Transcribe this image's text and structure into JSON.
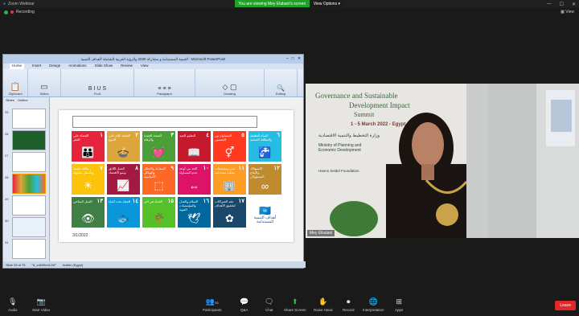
{
  "window": {
    "title": "Zoom Webinar",
    "recording_label": "Recording",
    "view_label": "View"
  },
  "share_banner": {
    "text": "You are viewing Mey Elabani's screen",
    "view_options": "View Options"
  },
  "powerpoint": {
    "title": "التنمية المستدامة و مشاركة 2030 والرؤية العربية الشاملة لأهداف التنمية - Microsoft PowerPoint",
    "tabs": [
      "Home",
      "Insert",
      "Design",
      "Animations",
      "Slide Show",
      "Review",
      "View"
    ],
    "ribbon_groups": [
      "Clipboard",
      "Slides",
      "Font",
      "Paragraph",
      "Drawing",
      "Editing"
    ],
    "sidebar_tabs": [
      "Slides",
      "Outline"
    ],
    "slide_numbers": [
      "25",
      "26",
      "27",
      "28",
      "29",
      "30",
      "31"
    ],
    "slide_date": "3/1/2022",
    "status": {
      "slide": "Slide 28 of 75",
      "theme": "\"8_cdb39e4124f\"",
      "language": "Arabic (Egypt)"
    },
    "sdg_tiles": [
      {
        "num": "١",
        "label": "القضاء على الفقر",
        "color": "#e5243b",
        "icon": "👪"
      },
      {
        "num": "٢",
        "label": "القضاء التام على الجوع",
        "color": "#dda63a",
        "icon": "🍲"
      },
      {
        "num": "٣",
        "label": "الصحة الجيدة والرفاه",
        "color": "#4c9f38",
        "icon": "💓"
      },
      {
        "num": "٤",
        "label": "التعليم الجيد",
        "color": "#c5192d",
        "icon": "📖"
      },
      {
        "num": "٥",
        "label": "المساواة بين الجنسين",
        "color": "#ff3a21",
        "icon": "⚥"
      },
      {
        "num": "٦",
        "label": "المياه النظيفة والنظافة الصحية",
        "color": "#26bde2",
        "icon": "🚰"
      },
      {
        "num": "٧",
        "label": "طاقة نظيفة وبأسعار معقولة",
        "color": "#fcc30b",
        "icon": "☀"
      },
      {
        "num": "٨",
        "label": "العمل اللائق ونمو الاقتصاد",
        "color": "#a21942",
        "icon": "📈"
      },
      {
        "num": "٩",
        "label": "الصناعة والابتكار والهياكل الأساسية",
        "color": "#fd6925",
        "icon": "⬚"
      },
      {
        "num": "١٠",
        "label": "الحد من أوجه عدم المساواة",
        "color": "#dd1367",
        "icon": "⇔"
      },
      {
        "num": "١١",
        "label": "مدن ومجتمعات محلية مستدامة",
        "color": "#fd9d24",
        "icon": "🏢"
      },
      {
        "num": "١٢",
        "label": "الاستهلاك والإنتاج المسؤولان",
        "color": "#bf8b2e",
        "icon": "∞"
      },
      {
        "num": "١٣",
        "label": "العمل المناخي",
        "color": "#3f7e44",
        "icon": "👁"
      },
      {
        "num": "١٤",
        "label": "الحياة تحت الماء",
        "color": "#0a97d9",
        "icon": "🐟"
      },
      {
        "num": "١٥",
        "label": "الحياة في البر",
        "color": "#56c02b",
        "icon": "🌴"
      },
      {
        "num": "١٦",
        "label": "السلام والعدل والمؤسسات القوية",
        "color": "#00689d",
        "icon": "🕊"
      },
      {
        "num": "١٧",
        "label": "عقد الشراكات لتحقيق الأهداف",
        "color": "#19486a",
        "icon": "✿"
      },
      {
        "num": "",
        "label": "أهداف التنمية المستدامة",
        "color": "#ffffff",
        "icon": "🇺🇳",
        "logo": true
      }
    ]
  },
  "video": {
    "banner_line1": "Governance and Sustainable",
    "banner_line2": "Development Impact",
    "banner_line3": "Summit",
    "banner_date": "1 - 5 March 2022 - Egypt",
    "banner_ministry_ar": "وزارة التخطيط والتنمية الاقتصادية",
    "banner_ministry_en": "Ministry of Planning and Economic Development",
    "banner_foundation": "Hanns Seidel Foundation",
    "participant_name": "Mey Elkalani"
  },
  "toolbar": {
    "audio": "Audio",
    "video": "Start Video",
    "participants": "Participants",
    "participants_count": "25",
    "qa": "Q&A",
    "chat": "Chat",
    "share": "Share Screen",
    "raise": "Raise Hand",
    "record": "Record",
    "interpretation": "Interpretation",
    "apps": "Apps",
    "leave": "Leave"
  }
}
